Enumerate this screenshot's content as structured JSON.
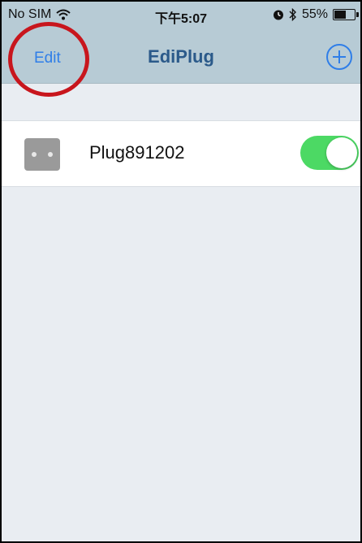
{
  "status_bar": {
    "carrier": "No SIM",
    "time": "下午5:07",
    "battery": "55%",
    "battery_level": 0.55,
    "icons": [
      "wifi-icon",
      "alarm-icon",
      "bluetooth-icon",
      "battery-icon"
    ]
  },
  "nav": {
    "edit_label": "Edit",
    "title": "EdiPlug",
    "add_icon": "plus-circle-icon"
  },
  "devices": [
    {
      "name": "Plug891202",
      "on": true
    }
  ],
  "colors": {
    "accent": "#2f7ee8",
    "nav_bg": "#b7cbd5",
    "toggle_on": "#4cd964",
    "highlight": "#c8161d"
  }
}
